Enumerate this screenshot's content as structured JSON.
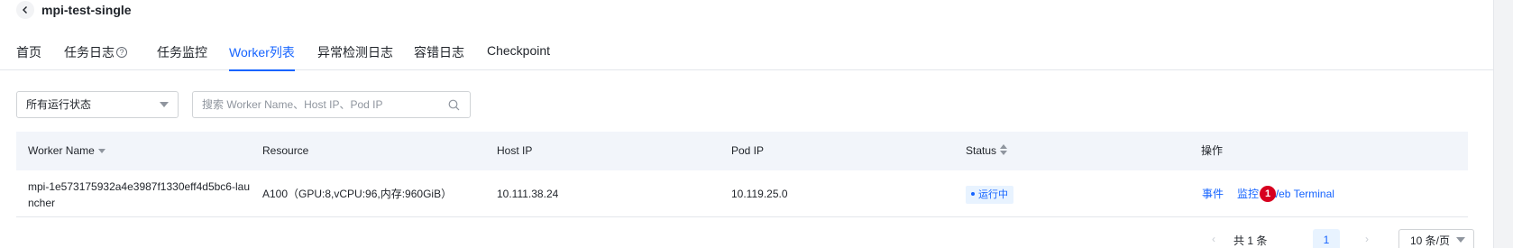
{
  "header": {
    "title": "mpi-test-single"
  },
  "tabs": [
    {
      "label": "首页"
    },
    {
      "label": "任务日志"
    },
    {
      "label": "任务监控"
    },
    {
      "label": "Worker列表"
    },
    {
      "label": "异常检测日志"
    },
    {
      "label": "容错日志"
    },
    {
      "label": "Checkpoint"
    }
  ],
  "tab_help_glyph": "?",
  "filters": {
    "status_select": "所有运行状态",
    "search_placeholder": "搜索 Worker Name、Host IP、Pod IP"
  },
  "table": {
    "columns": [
      "Worker Name",
      "Resource",
      "Host IP",
      "Pod IP",
      "Status",
      "操作"
    ],
    "rows": [
      {
        "worker_name": "mpi-1e573175932a4e3987f1330eff4d5bc6-launcher",
        "resource": "A100（GPU:8,vCPU:96,内存:960GiB）",
        "host_ip": "10.111.38.24",
        "pod_ip": "10.119.25.0",
        "status": "运行中",
        "actions": [
          "事件",
          "监控",
          "Web Terminal"
        ]
      }
    ]
  },
  "badge_count": "1",
  "pagination": {
    "total_text": "共 1 条",
    "current_page": "1",
    "page_size": "10 条/页",
    "prev_glyph": "‹",
    "next_glyph": "›"
  },
  "colors": {
    "accent": "#1664ff",
    "header_bg": "#f2f5fa",
    "badge_red": "#d7001f",
    "status_bg": "#e8f3ff"
  }
}
